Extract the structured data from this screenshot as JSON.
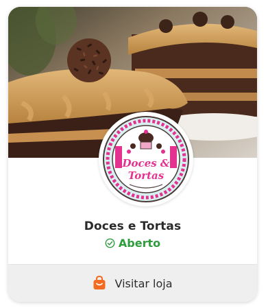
{
  "store": {
    "name": "Doces e Tortas",
    "status": "Aberto",
    "logo_text_line1": "Doces &",
    "logo_text_line2": "Tortas",
    "status_color": "#2e9d3c"
  },
  "actions": {
    "visit_label": "Visitar loja",
    "visit_icon": "shopping-bag-icon",
    "accent_color": "#f26b21"
  },
  "status_icon": "check-circle-icon"
}
